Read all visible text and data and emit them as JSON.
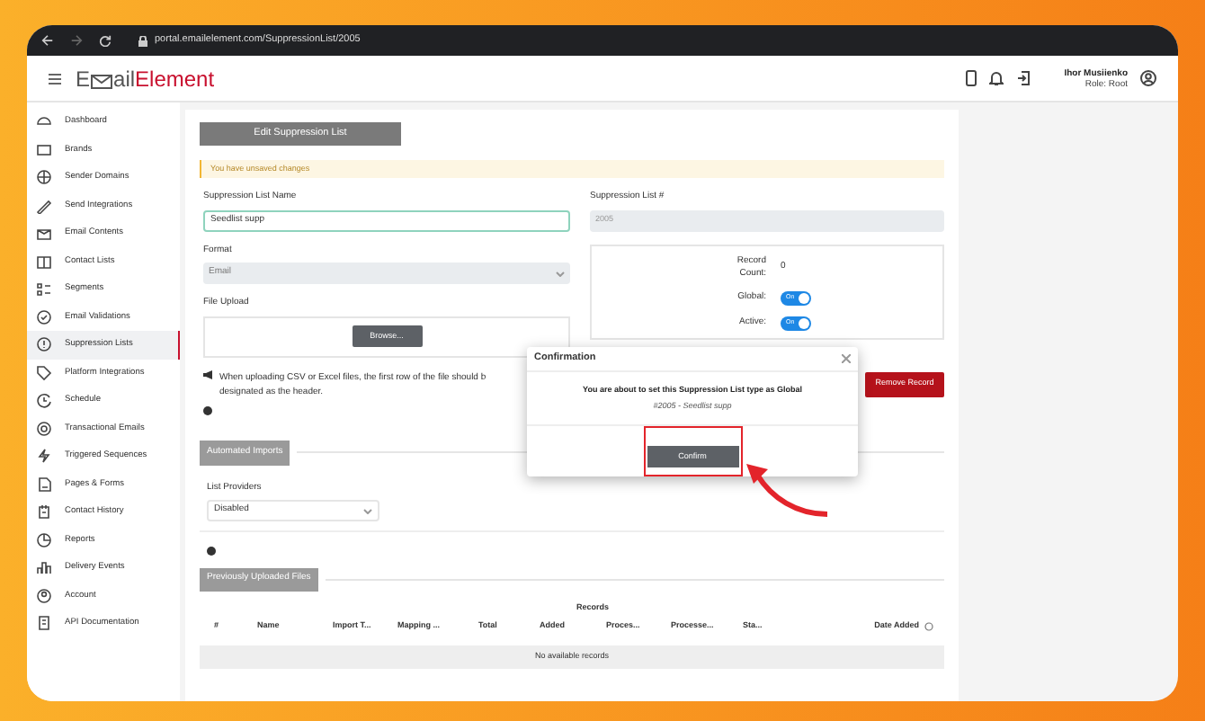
{
  "browser": {
    "url": "portal.emailelement.com/SuppressionList/2005"
  },
  "header": {
    "logo_start": "E",
    "logo_middle": "ail",
    "logo_end": "Element",
    "user_name": "Ihor Musiienko",
    "user_role": "Role: Root"
  },
  "sidebar": {
    "items": [
      {
        "label": "Dashboard",
        "selected": false
      },
      {
        "label": "Brands",
        "selected": false
      },
      {
        "label": "Sender Domains",
        "selected": false
      },
      {
        "label": "Send Integrations",
        "selected": false
      },
      {
        "label": "Email Contents",
        "selected": false
      },
      {
        "label": "Contact Lists",
        "selected": false
      },
      {
        "label": "Segments",
        "selected": false
      },
      {
        "label": "Email Validations",
        "selected": false
      },
      {
        "label": "Suppression Lists",
        "selected": true
      },
      {
        "label": "Platform Integrations",
        "selected": false
      },
      {
        "label": "Schedule",
        "selected": false
      },
      {
        "label": "Transactional Emails",
        "selected": false
      },
      {
        "label": "Triggered Sequences",
        "selected": false
      },
      {
        "label": "Pages & Forms",
        "selected": false
      },
      {
        "label": "Contact History",
        "selected": false
      },
      {
        "label": "Reports",
        "selected": false
      },
      {
        "label": "Delivery Events",
        "selected": false
      },
      {
        "label": "Account",
        "selected": false
      },
      {
        "label": "API Documentation",
        "selected": false
      }
    ]
  },
  "form": {
    "title": "Edit Suppression List",
    "alert": "You have unsaved changes",
    "name_label": "Suppression List Name",
    "name_value": "Seedlist supp",
    "number_label": "Suppression List #",
    "number_value": "2005",
    "format_label": "Format",
    "format_value": "Email",
    "upload_label": "File Upload",
    "browse_button": "Browse...",
    "upload_note": "When uploading CSV or Excel files, the first row of the file should b designated as the header.",
    "record_count_label": "Record Count:",
    "record_count": "0",
    "toggles": [
      {
        "label": "Global:",
        "text": "On",
        "on": true
      },
      {
        "label": "Active:",
        "text": "On",
        "on": true
      }
    ],
    "remove_button": "Remove Record"
  },
  "automated_imports": {
    "title": "Automated Imports",
    "providers_label": "List Providers",
    "providers_value": "Disabled"
  },
  "uploaded_files": {
    "title": "Previously Uploaded Files",
    "group_header": "Records",
    "columns": [
      "#",
      "Name",
      "Import T...",
      "Mapping ...",
      "Total",
      "Added",
      "Proces...",
      "Processe...",
      "Sta...",
      "Date Added"
    ],
    "empty_text": "No available records"
  },
  "dialog": {
    "title": "Confirmation",
    "message": "You are about to set this Suppression List type as Global",
    "detail": "#2005 - Seedlist supp",
    "confirm_button": "Confirm"
  }
}
